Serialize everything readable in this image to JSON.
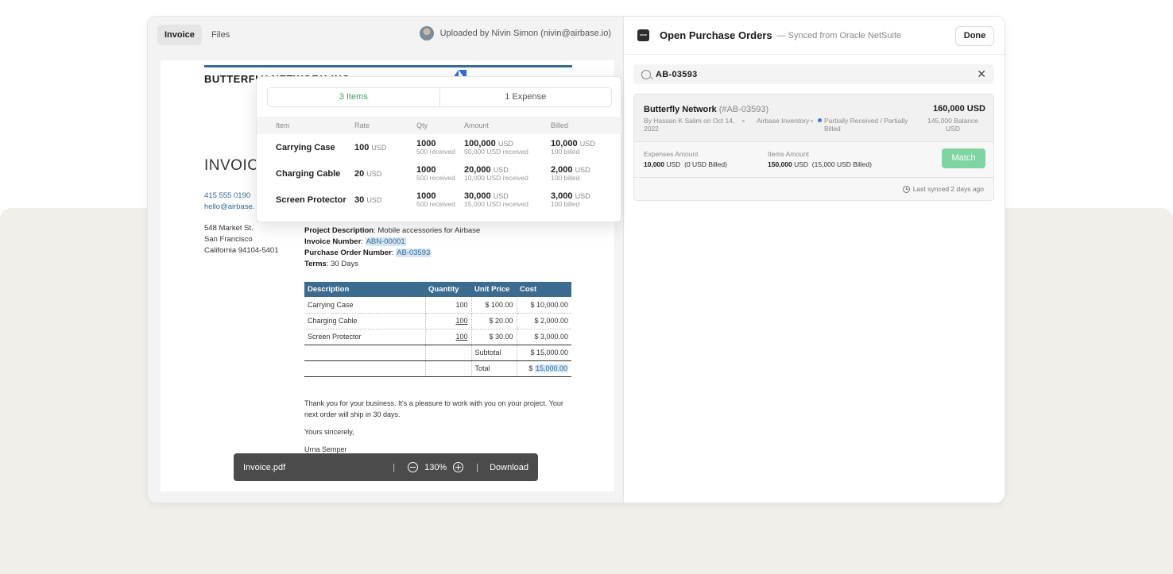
{
  "tabs": [
    {
      "label": "Invoice"
    },
    {
      "label": "Files"
    }
  ],
  "uploaded_by": "Uploaded by Nivin Simon (nivin@airbase.io)",
  "invoice_doc": {
    "company": "BUTTERFLY NETWORK INC",
    "heading": "INVOICE",
    "phone": "415 555 0190",
    "email": "hello@airbase.",
    "address": [
      "548 Market St.",
      "San Francisco",
      "California 94104-5401"
    ],
    "project_description_label": "Project Description",
    "project_description": ": Mobile accessories for Airbase",
    "invoice_number_label": "Invoice Number",
    "invoice_number": "ABN-00001",
    "po_number_label": "Purchase Order Number",
    "po_number": "AB-03593",
    "terms_label": "Terms",
    "terms": ": 30 Days",
    "table_headers": [
      "Description",
      "Quantity",
      "Unit Price",
      "Cost"
    ],
    "rows": [
      {
        "desc": "Carrying Case",
        "qty": "100",
        "price": "$ 100.00",
        "cost": "$ 10,000.00"
      },
      {
        "desc": "Charging Cable",
        "qty": "100",
        "price": "$ 20.00",
        "cost": "$ 2,000.00"
      },
      {
        "desc": "Screen Protector",
        "qty": "100",
        "price": "$ 30.00",
        "cost": "$ 3,000.00"
      }
    ],
    "subtotal_label": "Subtotal",
    "subtotal": "$ 15,000.00",
    "total_label": "Total",
    "total_currency": "$",
    "total": "15,000.00",
    "thanks": "Thank you for your business. It's a pleasure to work with you on your project. Your next order will ship in 30 days.",
    "sincerely": "Yours sincerely,",
    "signature": "Urna Semper"
  },
  "viewer": {
    "filename": "Invoice.pdf",
    "zoom": "130%",
    "download": "Download"
  },
  "popover": {
    "seg": [
      "3 Items",
      "1 Expense"
    ],
    "headers": [
      "Item",
      "Rate",
      "Qty",
      "Amount",
      "Billed"
    ],
    "items": [
      {
        "name": "Carrying Case",
        "rate": "100",
        "rate_unit": "USD",
        "qty": "1000",
        "qty_received": "500 received",
        "amount": "100,000",
        "amount_unit": "USD",
        "amount_received": "50,000 USD received",
        "billed": "10,000",
        "billed_unit": "USD",
        "billed_sub": "100 billed"
      },
      {
        "name": "Charging Cable",
        "rate": "20",
        "rate_unit": "USD",
        "qty": "1000",
        "qty_received": "500 received",
        "amount": "20,000",
        "amount_unit": "USD",
        "amount_received": "10,000 USD received",
        "billed": "2,000",
        "billed_unit": "USD",
        "billed_sub": "100 billed"
      },
      {
        "name": "Screen Protector",
        "rate": "30",
        "rate_unit": "USD",
        "qty": "1000",
        "qty_received": "500 received",
        "amount": "30,000",
        "amount_unit": "USD",
        "amount_received": "15,000 USD received",
        "billed": "3,000",
        "billed_unit": "USD",
        "billed_sub": "100 billed"
      }
    ]
  },
  "panel": {
    "title": "Open Purchase Orders",
    "subtitle": "— Synced from Oracle NetSuite",
    "done": "Done",
    "search_value": "AB-03593",
    "po": {
      "vendor": "Butterfly Network",
      "number": "(#AB-03593)",
      "by": "By Hassan K Salim on Oct 14, 2022",
      "source": "Airbase Inventory",
      "status": "Partially Received / Partially Billed",
      "amount": "160,000 USD",
      "balance": "145,000 Balance USD",
      "expenses_label": "Expenses Amount",
      "expenses_amount": "10,000",
      "expenses_unit": "USD",
      "expenses_billed": "(0 USD Billed)",
      "items_label": "Items Amount",
      "items_amount": "150,000",
      "items_unit": "USD",
      "items_billed": "(15,000 USD Billed)",
      "match": "Match",
      "last_synced": "Last synced 2 days ago"
    }
  }
}
